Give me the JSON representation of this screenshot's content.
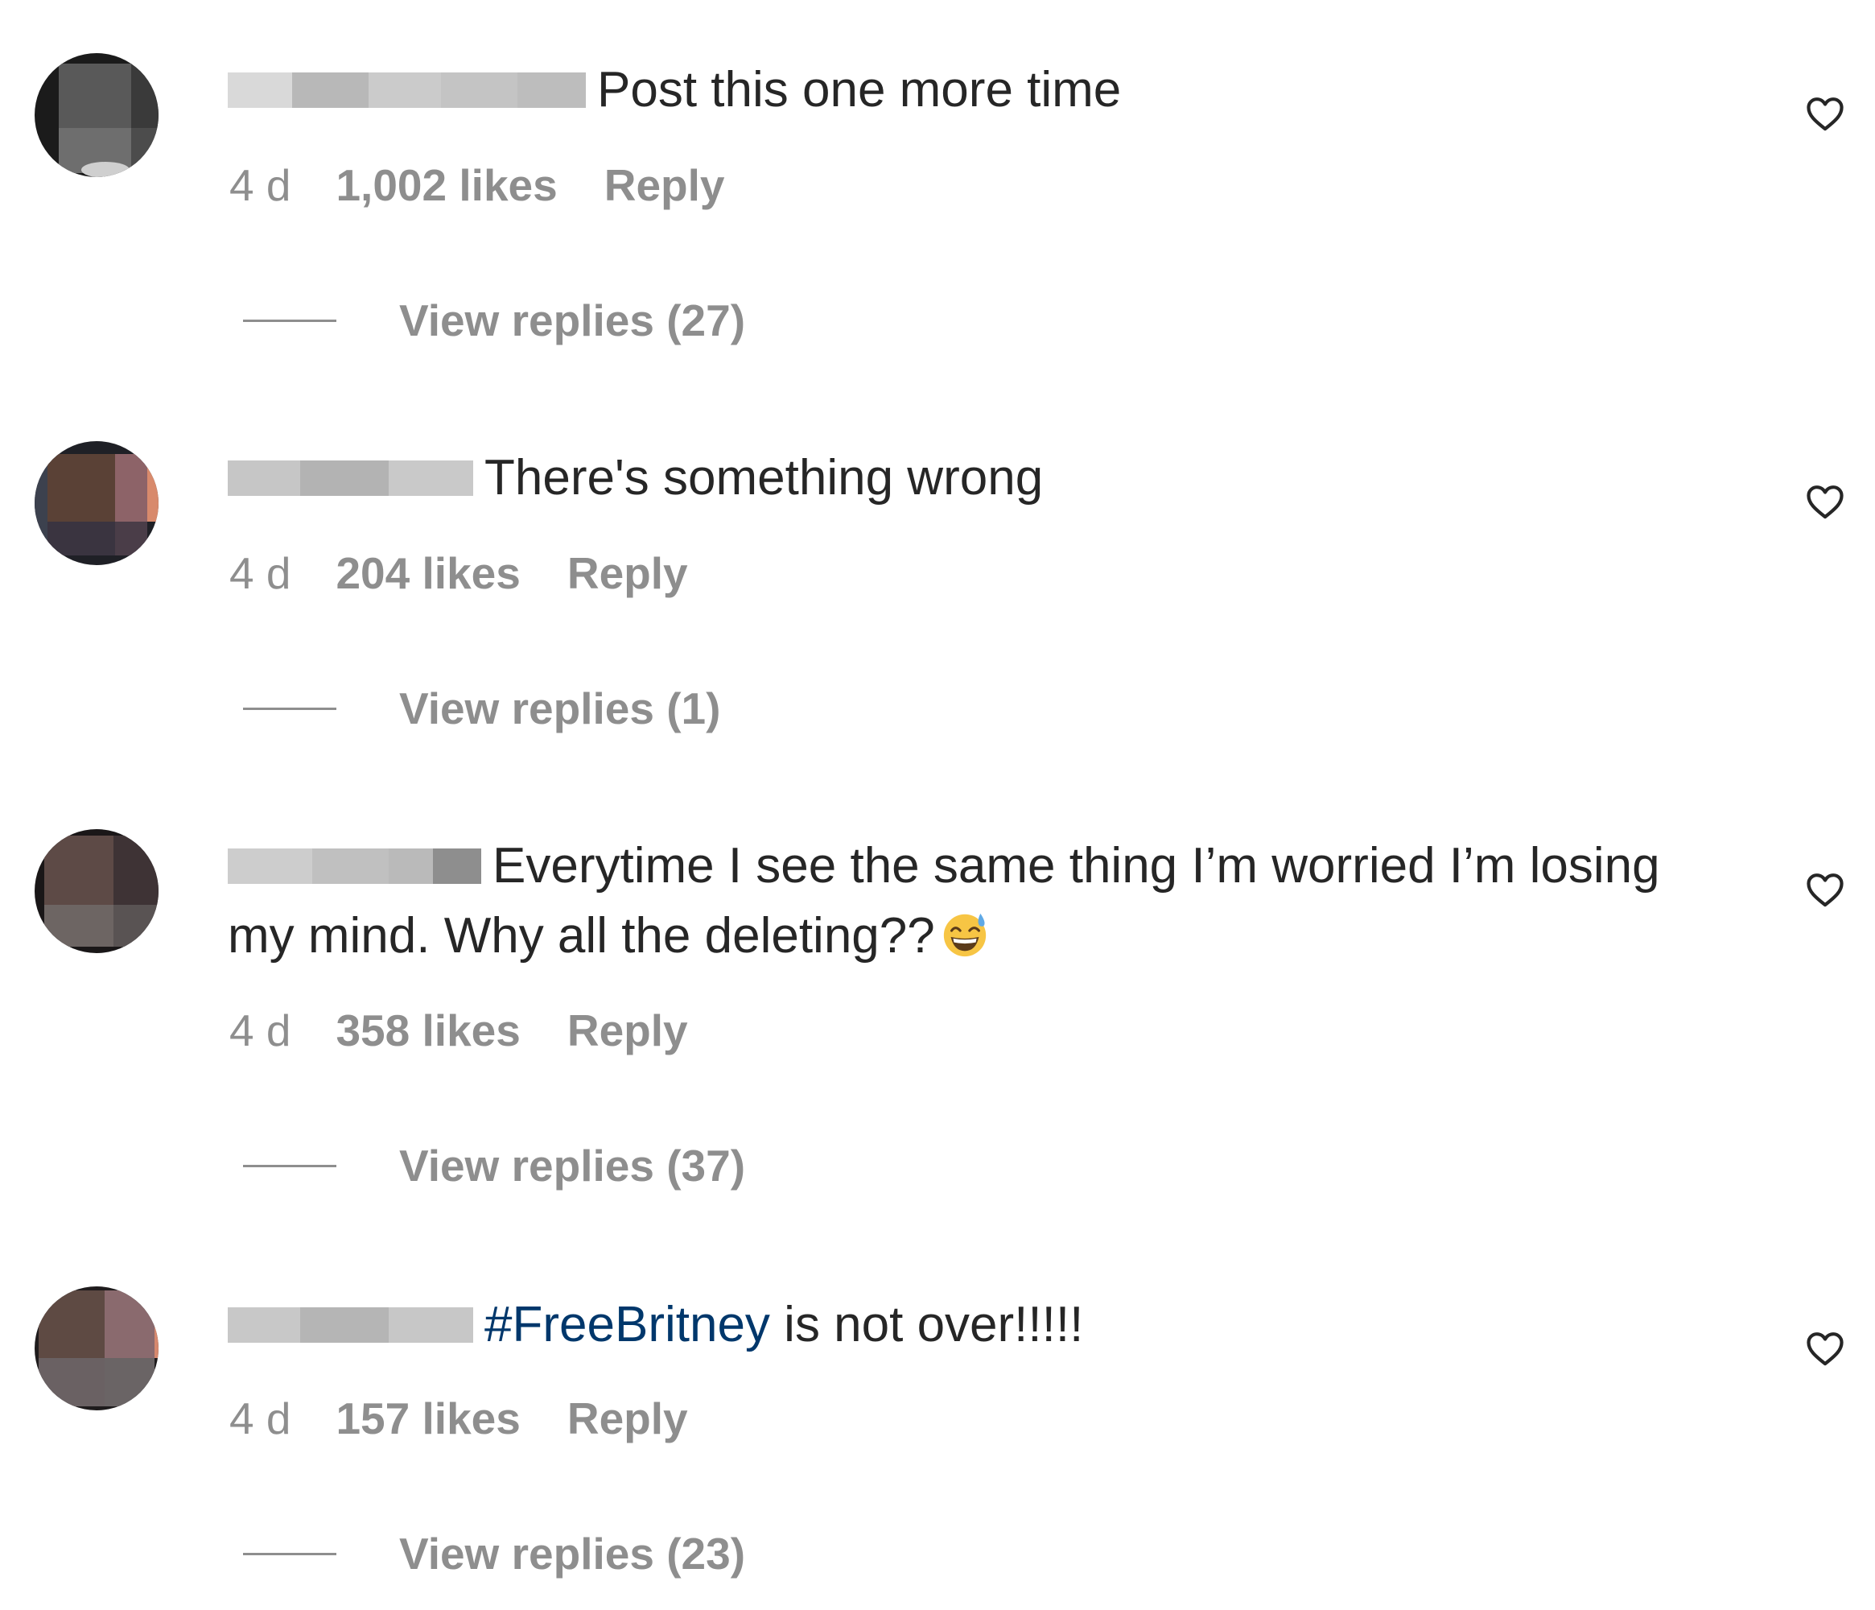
{
  "comments": [
    {
      "text": "Post this one more time",
      "hashtag": "",
      "age": "4 d",
      "likes": "1,002 likes",
      "reply_label": "Reply",
      "view_replies": "View replies (27)"
    },
    {
      "text": "There's something wrong",
      "hashtag": "",
      "age": "4 d",
      "likes": "204 likes",
      "reply_label": "Reply",
      "view_replies": "View replies (1)"
    },
    {
      "text": "Everytime I see the same thing I’m worried I’m losing my mind. Why all the deleting??",
      "emoji": "grinning-face-with-sweat",
      "hashtag": "",
      "age": "4 d",
      "likes": "358 likes",
      "reply_label": "Reply",
      "view_replies": "View replies (37)"
    },
    {
      "text": " is not over!!!!!",
      "hashtag": "#FreeBritney",
      "age": "4 d",
      "likes": "157 likes",
      "reply_label": "Reply",
      "view_replies": "View replies (23)"
    }
  ],
  "colors": {
    "text": "#262626",
    "secondary": "#8e8e8e",
    "hashtag": "#00376b",
    "background": "#ffffff"
  },
  "icons": {
    "like": "heart-outline-icon"
  }
}
